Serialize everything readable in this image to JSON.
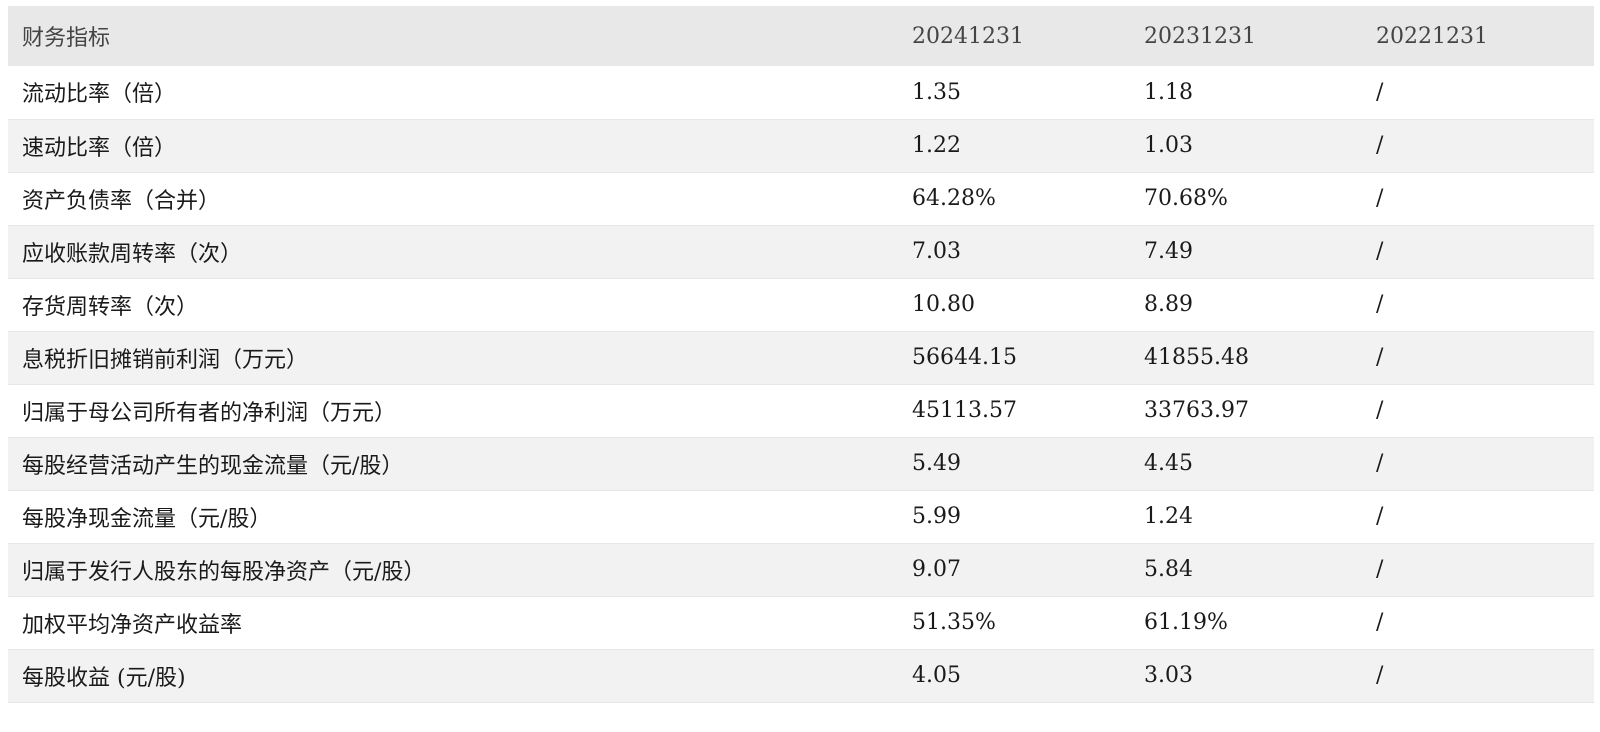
{
  "table": {
    "headers": [
      "财务指标",
      "20241231",
      "20231231",
      "20221231"
    ],
    "rows": [
      {
        "name": "流动比率（倍）",
        "v2024": "1.35",
        "v2023": "1.18",
        "v2022": "/"
      },
      {
        "name": "速动比率（倍）",
        "v2024": "1.22",
        "v2023": "1.03",
        "v2022": "/"
      },
      {
        "name": "资产负债率（合并）",
        "v2024": "64.28%",
        "v2023": "70.68%",
        "v2022": "/"
      },
      {
        "name": "应收账款周转率（次）",
        "v2024": "7.03",
        "v2023": "7.49",
        "v2022": "/"
      },
      {
        "name": "存货周转率（次）",
        "v2024": "10.80",
        "v2023": "8.89",
        "v2022": "/"
      },
      {
        "name": "息税折旧摊销前利润（万元）",
        "v2024": "56644.15",
        "v2023": "41855.48",
        "v2022": "/"
      },
      {
        "name": "归属于母公司所有者的净利润（万元）",
        "v2024": "45113.57",
        "v2023": "33763.97",
        "v2022": "/"
      },
      {
        "name": "每股经营活动产生的现金流量（元/股）",
        "v2024": "5.49",
        "v2023": "4.45",
        "v2022": "/"
      },
      {
        "name": "每股净现金流量（元/股）",
        "v2024": "5.99",
        "v2023": "1.24",
        "v2022": "/"
      },
      {
        "name": "归属于发行人股东的每股净资产（元/股）",
        "v2024": "9.07",
        "v2023": "5.84",
        "v2022": "/"
      },
      {
        "name": "加权平均净资产收益率",
        "v2024": "51.35%",
        "v2023": "61.19%",
        "v2022": "/"
      },
      {
        "name": "每股收益 (元/股)",
        "v2024": "4.05",
        "v2023": "3.03",
        "v2022": "/"
      }
    ]
  },
  "colors": {
    "header_bg": "#e8e8e8",
    "stripe_bg": "#f2f2f2",
    "text": "#1a1a1a"
  }
}
